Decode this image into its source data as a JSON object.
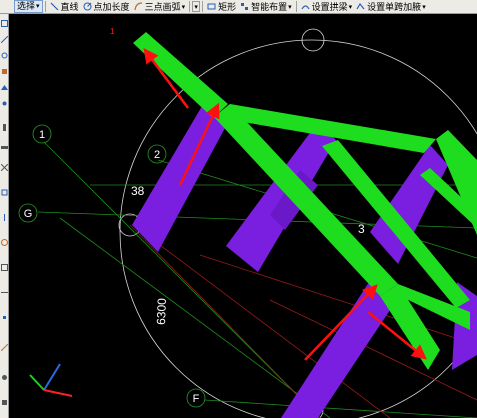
{
  "toolbar": {
    "select_label": "选择",
    "line_label": "直线",
    "add_length_label": "点加长度",
    "three_point_arc_label": "三点画弧",
    "rect_label": "矩形",
    "smart_layout_label": "智能布置",
    "set_arch_beam_label": "设置拱梁",
    "set_single_span_label": "设置单跨加腋"
  },
  "drawing": {
    "axis_labels": [
      "1",
      "2",
      "G",
      "F"
    ],
    "dim_38": "38",
    "dim_3": "3",
    "dim_6300": "6300",
    "mark_red": "1"
  },
  "colors": {
    "beam_green": "#1edc1e",
    "column_purple": "#7a1ee0",
    "arrow_red": "#ff1010",
    "grid_green": "#1e8c1e",
    "grid_red": "#9a1a1a",
    "circle_white": "#d8d8d8",
    "toolbar_bg": "#ecebe6"
  },
  "icons": [
    "select-icon",
    "line-icon",
    "add-length-icon",
    "arc-icon",
    "rect-icon",
    "smart-layout-icon",
    "arch-beam-icon",
    "single-span-icon"
  ]
}
